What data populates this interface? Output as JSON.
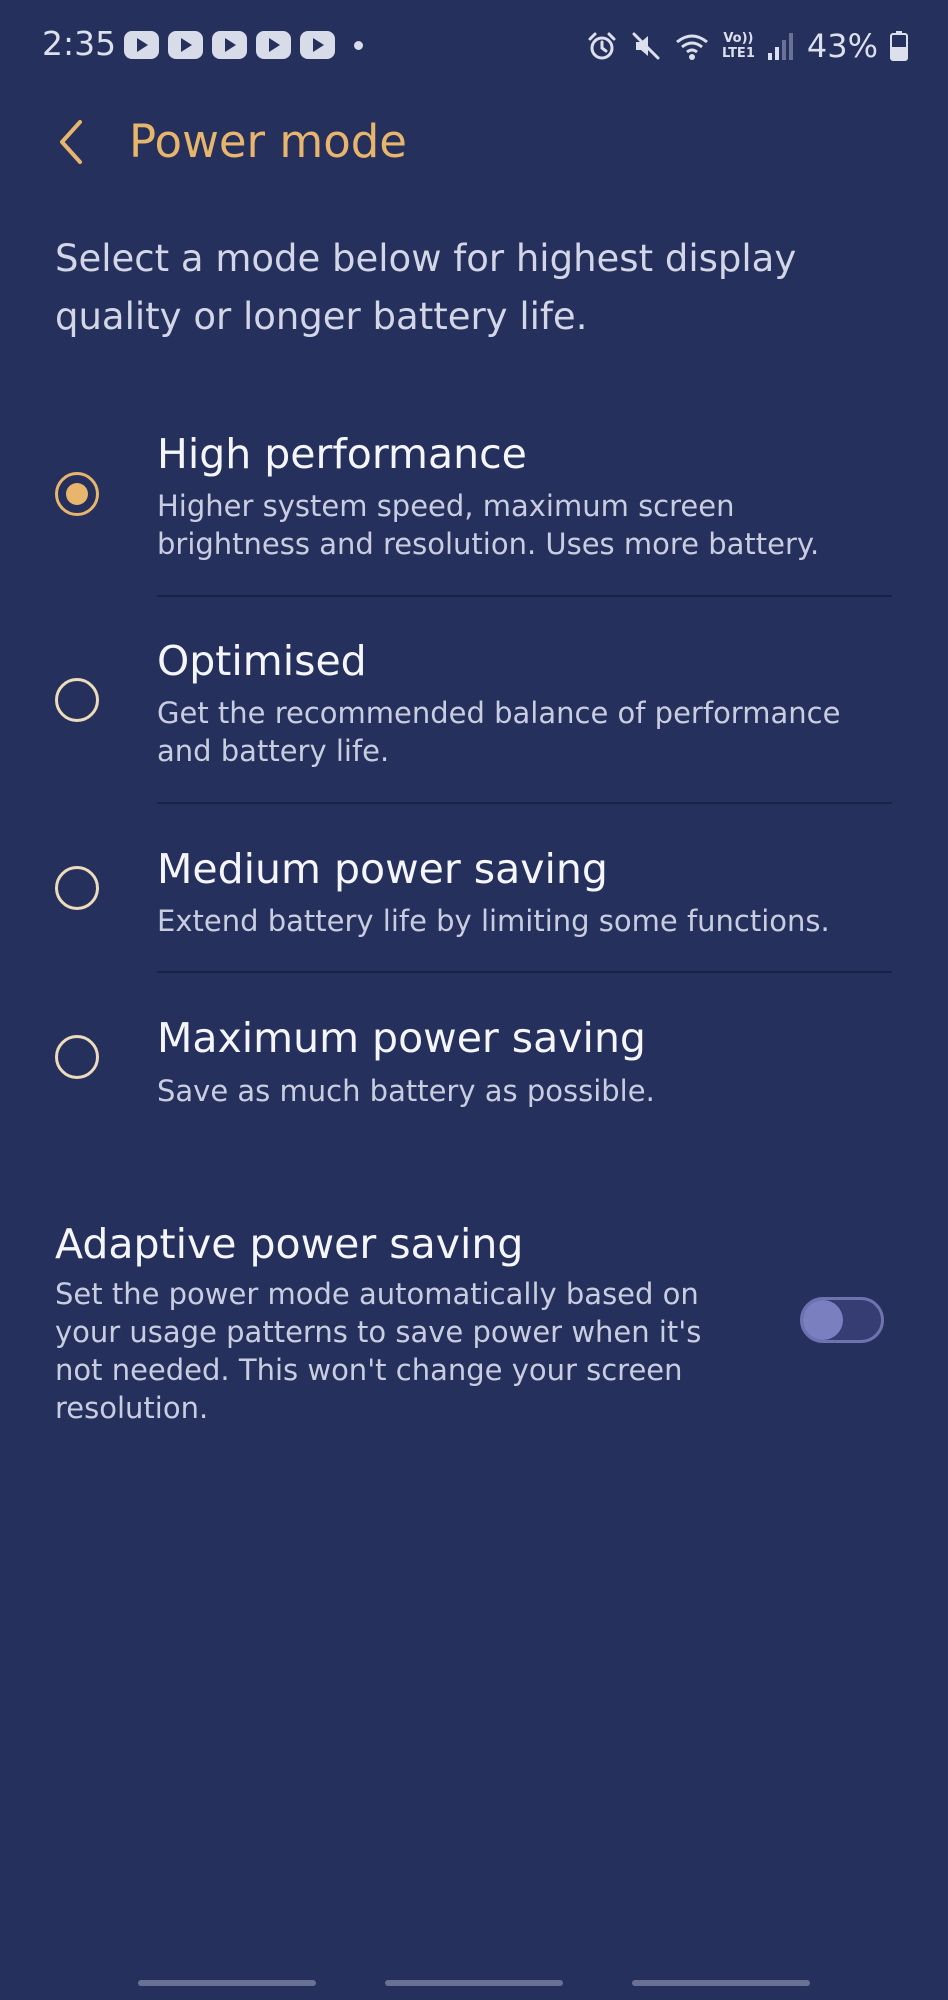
{
  "status_bar": {
    "time": "2:35",
    "notification_icons": [
      "youtube-icon",
      "youtube-icon",
      "youtube-icon",
      "youtube-icon",
      "youtube-icon",
      "dot-icon"
    ],
    "system_icons": [
      "alarm-icon",
      "mute-icon",
      "wifi-icon",
      "volte-icon",
      "signal-icon",
      "battery-icon"
    ],
    "volte_line1": "Vo))",
    "volte_line2": "LTE1",
    "battery_percent": "43%"
  },
  "header": {
    "title": "Power mode",
    "back_icon": "chevron-left-icon"
  },
  "intro_text": "Select a mode below for highest display quality or longer battery life.",
  "modes": [
    {
      "title": "High performance",
      "description": "Higher system speed, maximum screen brightness and resolution. Uses more battery.",
      "selected": true
    },
    {
      "title": "Optimised",
      "description": "Get the recommended balance of performance and battery life.",
      "selected": false
    },
    {
      "title": "Medium power saving",
      "description": "Extend battery life by limiting some functions.",
      "selected": false
    },
    {
      "title": "Maximum power saving",
      "description": "Save as much battery as possible.",
      "selected": false
    }
  ],
  "adaptive": {
    "title": "Adaptive power saving",
    "description": "Set the power mode automatically based on your usage patterns to save power when it's not needed. This won't change your screen resolution.",
    "enabled": false
  },
  "colors": {
    "background": "#26305c",
    "accent": "#e8b56c",
    "text_primary": "#f5f6fb",
    "text_secondary": "#c9cde0"
  }
}
